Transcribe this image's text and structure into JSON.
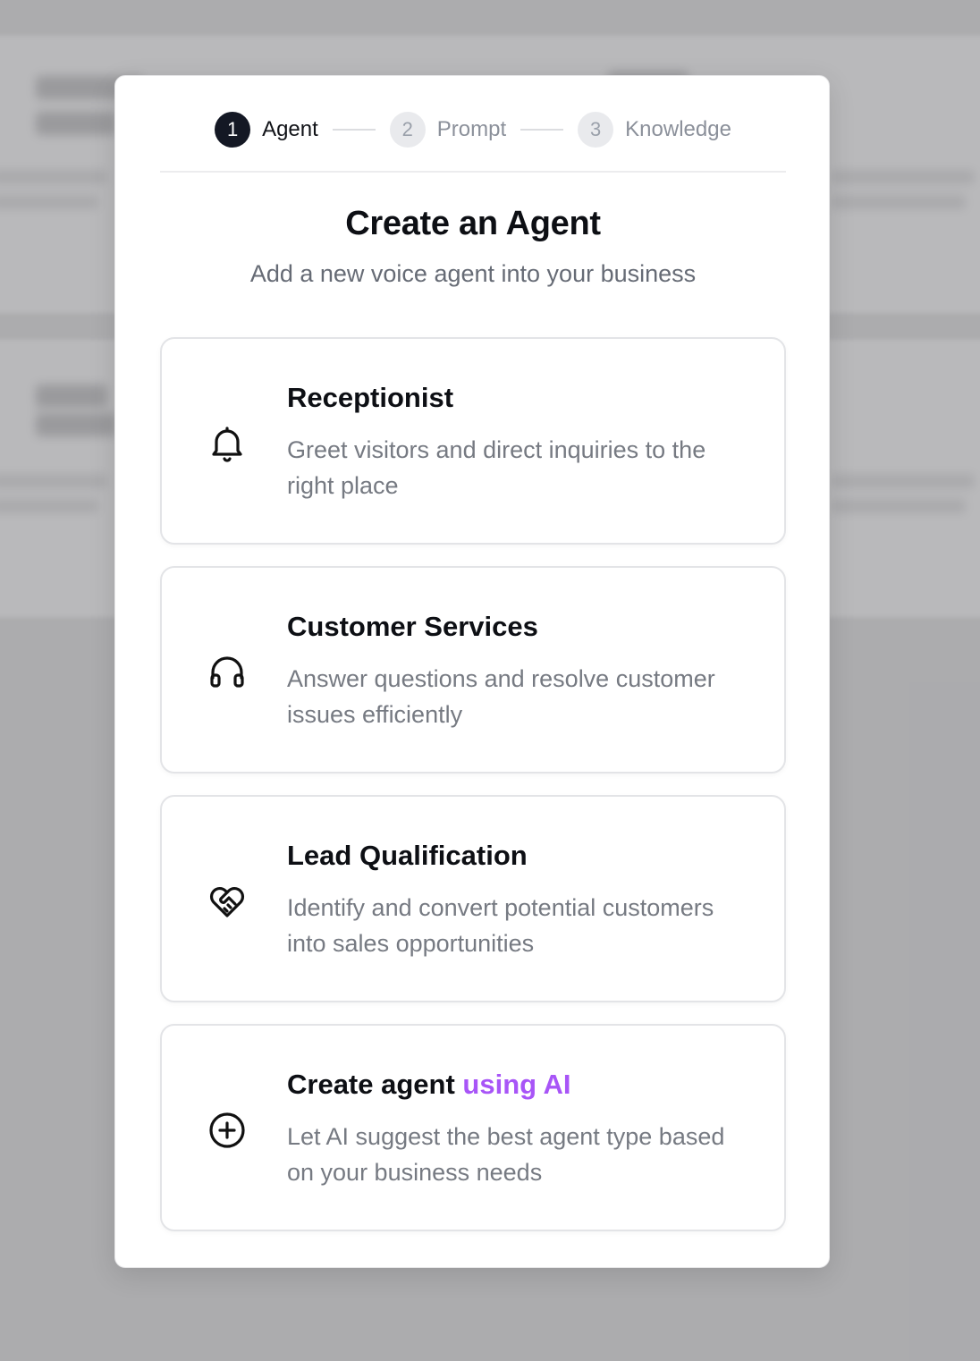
{
  "stepper": {
    "steps": [
      {
        "number": "1",
        "label": "Agent",
        "state": "active"
      },
      {
        "number": "2",
        "label": "Prompt",
        "state": "inactive"
      },
      {
        "number": "3",
        "label": "Knowledge",
        "state": "inactive"
      }
    ]
  },
  "dialog": {
    "title": "Create an Agent",
    "subtitle": "Add a new voice agent into your business"
  },
  "options": [
    {
      "title": "Receptionist",
      "description": "Greet visitors and direct inquiries to the right place",
      "icon": "bell-icon"
    },
    {
      "title": "Customer Services",
      "description": "Answer questions and resolve customer issues efficiently",
      "icon": "headphones-icon"
    },
    {
      "title": "Lead Qualification",
      "description": "Identify and convert potential customers into sales opportunities",
      "icon": "handshake-heart-icon"
    },
    {
      "title_prefix": "Create agent ",
      "title_accent": "using AI",
      "description": "Let AI suggest the best agent type based on your business needs",
      "icon": "plus-circle-icon"
    }
  ],
  "colors": {
    "accent": "#a855f7",
    "active_step": "#141824",
    "backdrop": "#bdbdbf"
  }
}
